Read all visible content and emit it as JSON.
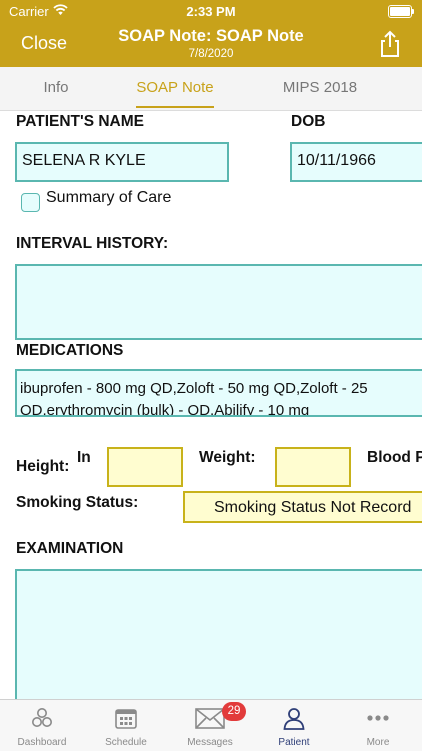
{
  "status_bar": {
    "carrier": "Carrier",
    "time": "2:33 PM"
  },
  "nav": {
    "close_label": "Close",
    "title": "SOAP Note: SOAP Note",
    "subtitle": "7/8/2020",
    "share_icon": "share-icon"
  },
  "tabs": [
    {
      "label": "Info",
      "active": false
    },
    {
      "label": "SOAP Note",
      "active": true
    },
    {
      "label": "MIPS 2018",
      "active": false
    }
  ],
  "form": {
    "patient_name_label": "PATIENT'S NAME",
    "patient_name_value": "SELENA R KYLE",
    "dob_label": "DOB",
    "dob_value": "10/11/1966",
    "summary_of_care_label": "Summary of Care",
    "interval_history_label": "INTERVAL HISTORY:",
    "interval_history_value": "",
    "medications_label": "MEDICATIONS",
    "medications_line1": "ibuprofen - 800 mg QD,Zoloft - 50 mg QD,Zoloft - 25",
    "medications_line2": "QD,erythromycin (bulk) -  QD,Abilify - 10 mg",
    "height_label": "Height:",
    "height_unit": "In",
    "weight_label": "Weight:",
    "blood_pressure_label": "Blood P",
    "smoking_label": "Smoking Status:",
    "smoking_value": "Smoking Status Not Record",
    "examination_label": "EXAMINATION",
    "examination_value": ""
  },
  "tabbar": {
    "items": [
      {
        "label": "Dashboard",
        "icon": "dashboard-icon",
        "active": false
      },
      {
        "label": "Schedule",
        "icon": "calendar-icon",
        "active": false
      },
      {
        "label": "Messages",
        "icon": "envelope-icon",
        "active": false
      },
      {
        "label": "Patient",
        "icon": "person-icon",
        "active": true
      },
      {
        "label": "More",
        "icon": "more-dots-icon",
        "active": false
      }
    ],
    "messages_badge": "29"
  },
  "colors": {
    "accent": "#c8a21a",
    "field_bg": "#e6fdfd",
    "field_border": "#5ab7b0",
    "yellow_field": "#fffdd0",
    "badge": "#e23b3b",
    "active_tab": "#2f3f78"
  }
}
